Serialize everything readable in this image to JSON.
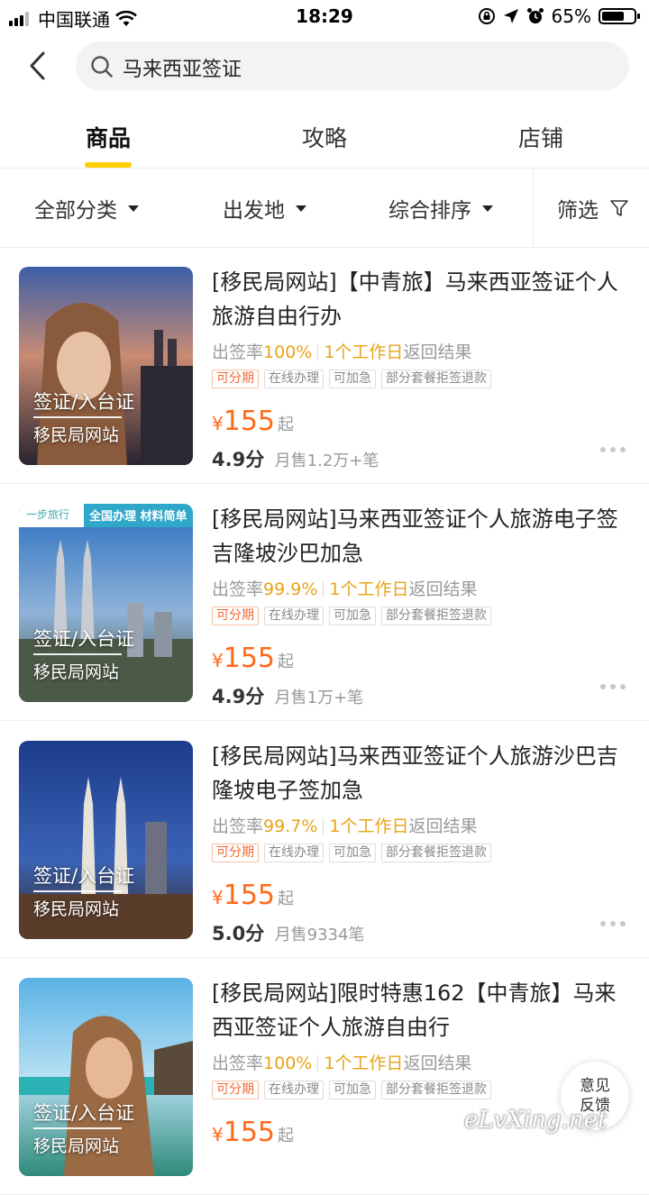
{
  "status_bar": {
    "carrier": "中国联通",
    "time": "18:29",
    "battery": "65%",
    "icons": [
      "signal-icon",
      "wifi-icon",
      "orientation-lock-icon",
      "location-arrow-icon",
      "alarm-icon",
      "battery-icon"
    ]
  },
  "search": {
    "query": "马来西亚签证",
    "icon": "search-icon"
  },
  "tabs": [
    {
      "label": "商品",
      "active": true
    },
    {
      "label": "攻略",
      "active": false
    },
    {
      "label": "店铺",
      "active": false
    }
  ],
  "filters": {
    "category": "全部分类",
    "origin": "出发地",
    "sort": "综合排序",
    "screen": "筛选"
  },
  "products": [
    {
      "title": "[移民局网站]【中青旅】马来西亚签证个人旅游自由行办",
      "thumb_caption": "签证/入台证",
      "thumb_sub": "移民局网站",
      "rate_label": "出签率",
      "rate": "100%",
      "days": "1个工作日",
      "days_suffix": "返回结果",
      "tags": [
        "可分期",
        "在线办理",
        "可加急",
        "部分套餐拒签退款"
      ],
      "currency": "¥",
      "price": "155",
      "price_suffix": "起",
      "score": "4.9分",
      "sales": "月售1.2万+笔"
    },
    {
      "title": "[移民局网站]马来西亚签证个人旅游电子签吉隆坡沙巴加急",
      "thumb_caption": "签证/入台证",
      "thumb_sub": "移民局网站",
      "thumb_banner_left": "一步旅行",
      "thumb_banner_right": "全国办理 材料简单",
      "rate_label": "出签率",
      "rate": "99.9%",
      "days": "1个工作日",
      "days_suffix": "返回结果",
      "tags": [
        "可分期",
        "在线办理",
        "可加急",
        "部分套餐拒签退款"
      ],
      "currency": "¥",
      "price": "155",
      "price_suffix": "起",
      "score": "4.9分",
      "sales": "月售1万+笔"
    },
    {
      "title": "[移民局网站]马来西亚签证个人旅游沙巴吉隆坡电子签加急",
      "thumb_caption": "签证/入台证",
      "thumb_sub": "移民局网站",
      "rate_label": "出签率",
      "rate": "99.7%",
      "days": "1个工作日",
      "days_suffix": "返回结果",
      "tags": [
        "可分期",
        "在线办理",
        "可加急",
        "部分套餐拒签退款"
      ],
      "currency": "¥",
      "price": "155",
      "price_suffix": "起",
      "score": "5.0分",
      "sales": "月售9334笔"
    },
    {
      "title": "[移民局网站]限时特惠162【中青旅】马来西亚签证个人旅游自由行",
      "thumb_caption": "签证/入台证",
      "thumb_sub": "移民局网站",
      "rate_label": "出签率",
      "rate": "100%",
      "days": "1个工作日",
      "days_suffix": "返回结果",
      "tags": [
        "可分期",
        "在线办理",
        "可加急",
        "部分套餐拒签退款"
      ],
      "currency": "¥",
      "price": "155",
      "price_suffix": "起"
    }
  ],
  "feedback": {
    "line1": "意见",
    "line2": "反馈"
  },
  "watermark": "eLvXing.net",
  "colors": {
    "accent": "#ffcd00",
    "price": "#ff6a1a",
    "rate": "#e8a317",
    "search_bg": "#f2f3f5"
  }
}
